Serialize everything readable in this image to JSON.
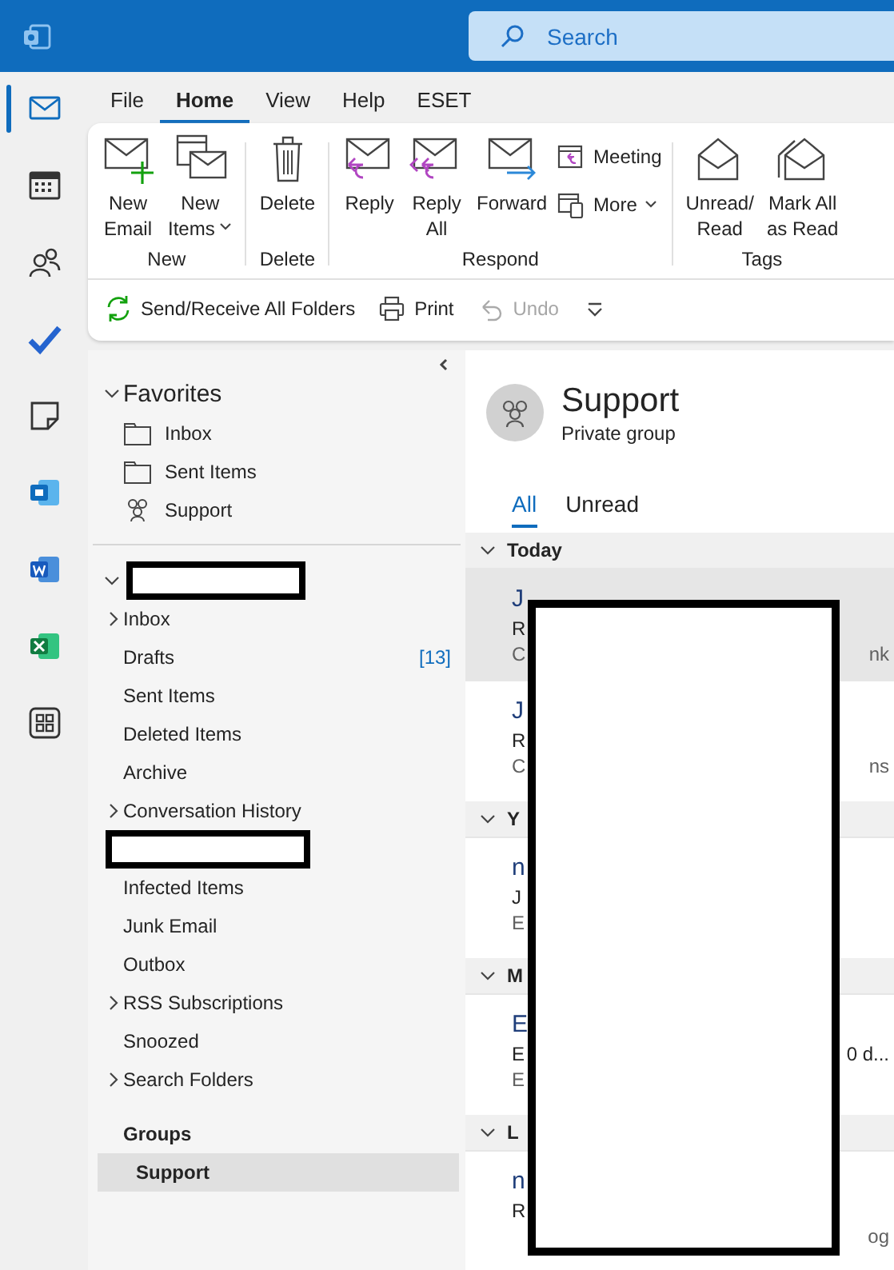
{
  "app_bar": {
    "search": {
      "placeholder": "Search"
    }
  },
  "rail": [
    {
      "kind": "mail",
      "selected": true
    },
    {
      "kind": "calendar",
      "selected": false
    },
    {
      "kind": "people",
      "selected": false
    },
    {
      "kind": "todo",
      "selected": false
    },
    {
      "kind": "note",
      "selected": false
    },
    {
      "kind": "app",
      "selected": false
    },
    {
      "kind": "word",
      "selected": false
    },
    {
      "kind": "excel",
      "selected": false
    },
    {
      "kind": "apps",
      "selected": false
    }
  ],
  "menu_tabs": [
    {
      "label": "File",
      "selected": false
    },
    {
      "label": "Home",
      "selected": true
    },
    {
      "label": "View",
      "selected": false
    },
    {
      "label": "Help",
      "selected": false
    },
    {
      "label": "ESET",
      "selected": false
    }
  ],
  "ribbon": {
    "groups": [
      {
        "label": "New",
        "buttons": [
          {
            "kind": "new-email",
            "lines": [
              "New",
              "Email"
            ],
            "dropdown": false
          },
          {
            "kind": "new-items",
            "lines": [
              "New",
              "Items"
            ],
            "dropdown": true
          }
        ]
      },
      {
        "label": "Delete",
        "buttons": [
          {
            "kind": "delete",
            "lines": [
              "Delete"
            ],
            "dropdown": false
          }
        ]
      },
      {
        "label": "Respond",
        "buttons": [
          {
            "kind": "reply",
            "lines": [
              "Reply"
            ],
            "dropdown": false
          },
          {
            "kind": "reply-all",
            "lines": [
              "Reply",
              "All"
            ],
            "dropdown": false
          },
          {
            "kind": "forward",
            "lines": [
              "Forward"
            ],
            "dropdown": false
          }
        ],
        "small_buttons": [
          {
            "kind": "meeting",
            "label": "Meeting",
            "dropdown": false
          },
          {
            "kind": "more",
            "label": "More",
            "dropdown": true
          }
        ]
      },
      {
        "label": "Tags",
        "buttons": [
          {
            "kind": "unread",
            "lines": [
              "Unread/",
              "Read"
            ],
            "dropdown": false
          },
          {
            "kind": "mark-all",
            "lines": [
              "Mark All",
              "as Read"
            ],
            "dropdown": false
          }
        ]
      }
    ]
  },
  "toolbar": [
    {
      "kind": "sync",
      "label": "Send/Receive All Folders",
      "disabled": false
    },
    {
      "kind": "print",
      "label": "Print",
      "disabled": false
    },
    {
      "kind": "undo",
      "label": "Undo",
      "disabled": true
    },
    {
      "kind": "customize",
      "disabled": false
    }
  ],
  "folder_pane": {
    "favorites": {
      "label": "Favorites",
      "expanded": true,
      "items": [
        {
          "kind": "folder",
          "label": "Inbox"
        },
        {
          "kind": "folder",
          "label": "Sent Items"
        },
        {
          "kind": "group",
          "label": "Support"
        }
      ]
    },
    "account": {
      "expanded": true,
      "redacted": true,
      "items": [
        {
          "kind": "folder",
          "label": "Inbox",
          "expandable": true
        },
        {
          "kind": "folder",
          "label": "Drafts",
          "count": "[13]",
          "expandable": false
        },
        {
          "kind": "folder",
          "label": "Sent Items",
          "expandable": false
        },
        {
          "kind": "folder",
          "label": "Deleted Items",
          "expandable": false
        },
        {
          "kind": "folder",
          "label": "Archive",
          "expandable": false
        },
        {
          "kind": "folder",
          "label": "Conversation History",
          "expandable": true
        },
        {
          "kind": "redacted"
        },
        {
          "kind": "folder",
          "label": "Infected Items",
          "expandable": false
        },
        {
          "kind": "folder",
          "label": "Junk Email",
          "expandable": false
        },
        {
          "kind": "folder",
          "label": "Outbox",
          "expandable": false
        },
        {
          "kind": "folder",
          "label": "RSS Subscriptions",
          "expandable": true
        },
        {
          "kind": "folder",
          "label": "Snoozed",
          "expandable": false
        },
        {
          "kind": "folder",
          "label": "Search Folders",
          "expandable": true
        }
      ]
    },
    "groups": {
      "label": "Groups",
      "items": [
        {
          "label": "Support",
          "selected": true
        }
      ]
    }
  },
  "message_pane": {
    "title": "Support",
    "subtitle": "Private group",
    "filters": [
      {
        "label": "All",
        "selected": true
      },
      {
        "label": "Unread",
        "selected": false
      }
    ],
    "redacted": true,
    "sections": [
      {
        "label": "Today",
        "expanded": true,
        "messages": [
          {
            "sender": "J",
            "subject": "R",
            "preview": "C",
            "preview_tail": "nk",
            "selected": true
          },
          {
            "sender": "J",
            "subject": "R",
            "preview": "C",
            "preview_tail": "ns",
            "selected": false
          }
        ]
      },
      {
        "label": "Y",
        "expanded": true,
        "messages": [
          {
            "sender": "n",
            "subject": "J",
            "preview": "E",
            "selected": false
          }
        ]
      },
      {
        "label": "M",
        "expanded": true,
        "messages": [
          {
            "sender": "E",
            "subject": "E",
            "preview": "E",
            "subject_tail": "0 d...",
            "selected": false
          }
        ]
      },
      {
        "label": "L",
        "expanded": true,
        "messages": [
          {
            "sender": "n",
            "subject": "R",
            "preview_tail": "og",
            "selected": false
          }
        ]
      }
    ]
  }
}
